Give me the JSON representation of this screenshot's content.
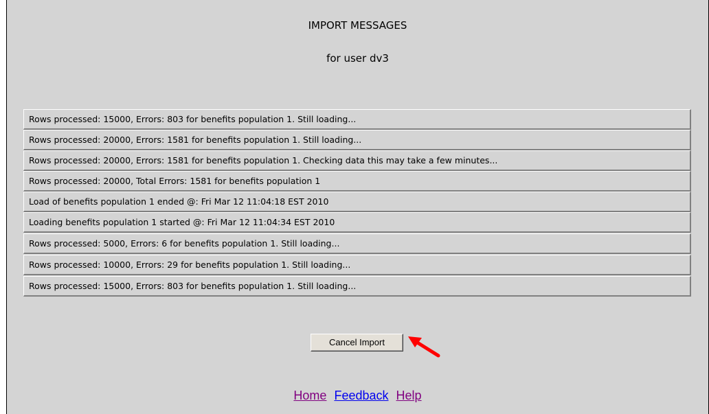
{
  "header": {
    "title": "IMPORT MESSAGES",
    "subtitle": "for user dv3"
  },
  "messages": [
    "Rows processed: 15000, Errors: 803 for benefits population 1. Still loading...",
    "Rows processed: 20000, Errors: 1581 for benefits population 1. Still loading...",
    "Rows processed: 20000, Errors: 1581 for benefits population 1. Checking data this may take a few minutes...",
    "Rows processed: 20000, Total Errors: 1581 for benefits population 1",
    "Load of benefits population 1 ended @: Fri Mar 12 11:04:18 EST 2010",
    "Loading benefits population 1 started @: Fri Mar 12 11:04:34 EST 2010",
    "Rows processed: 5000, Errors: 6 for benefits population 1. Still loading...",
    "Rows processed: 10000, Errors: 29 for benefits population 1. Still loading...",
    "Rows processed: 15000, Errors: 803 for benefits population 1. Still loading..."
  ],
  "actions": {
    "cancel_label": "Cancel Import",
    "arrow_icon": "red-arrow-icon"
  },
  "footer": {
    "home": "Home",
    "feedback": "Feedback",
    "help": "Help"
  },
  "colors": {
    "background": "#d4d4d4",
    "arrow": "#ff0000",
    "link_visited": "#800080",
    "link_unvisited": "#0000ee"
  }
}
